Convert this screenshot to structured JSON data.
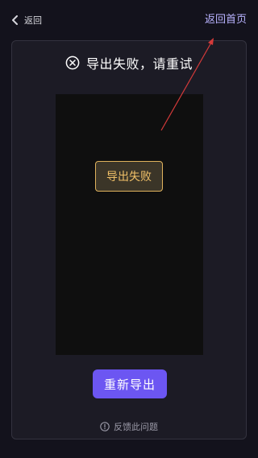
{
  "topbar": {
    "back_label": "返回",
    "home_label": "返回首页"
  },
  "status": {
    "icon": "circle-x-icon",
    "message": "导出失败，请重试"
  },
  "preview": {
    "badge_label": "导出失败"
  },
  "actions": {
    "retry_label": "重新导出",
    "feedback_label": "反馈此问题",
    "feedback_icon": "info-circle-icon"
  },
  "colors": {
    "background": "#13121c",
    "card": "#1c1b25",
    "accent": "#6c56f2",
    "link": "#b9b3ff",
    "badge_border": "#e0b35d",
    "annotation": "#d43a3a"
  }
}
